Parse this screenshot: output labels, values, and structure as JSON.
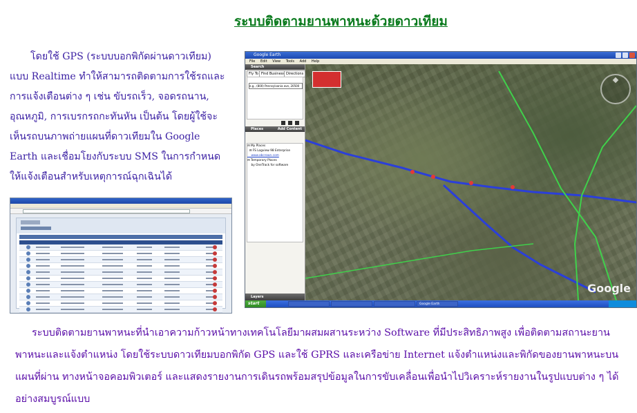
{
  "page": {
    "title": "ระบบติดตามยานพาหนะด้วยดาวเทียม",
    "intro_paragraph": "โดยใช้ GPS (ระบบบอกพิกัดผ่านดาวเทียม) แบบ Realtime ทำให้สามารถติดตามการใช้รถและการแจ้งเตือนต่าง ๆ เช่น ขับรถเร็ว, จอดรถนาน, อุณหภูมิ, การเบรกรถกะทันหัน เป็นต้น  โดยผู้ใช้จะเห็นรถบนภาพถ่ายแผนที่ดาวเทียมใน Google Earth และเชื่อมโยงกับระบบ SMS ในการกำหนดให้แจ้งเตือนสำหรับเหตุการณ์ฉุกเฉินได้",
    "bottom_paragraph": "ระบบติดตามยานพาหนะที่นำเอาความก้าวหน้าทางเทคโนโลยีมาผสมผสานระหว่าง Software ที่มีประสิทธิภาพสูง เพื่อติดตามสถานะยานพาหนะและแจ้งตำแหน่ง โดยใช้ระบบดาวเทียมบอกพิกัด GPS และใช้ GPRS และเครือข่าย Internet แจ้งตำแหน่งและพิกัดของยานพาหนะบนแผนที่ผ่าน ทางหน้าจอคอมพิวเตอร์ และแสดงรายงานการเดินรถพร้อมสรุปข้อมูลในการขับเคลื่อนเพื่อนำไปวิเคราะห์รายงานในรูปแบบต่าง ๆ ได้ อย่างสมบูรณ์แบบ"
  },
  "colors": {
    "title": "#0a7a1d",
    "intro_text": "#3a1fa3",
    "bottom_text": "#5a0ea8"
  },
  "google_earth_screenshot": {
    "window_title": "Google Earth",
    "menu": [
      "File",
      "Edit",
      "View",
      "Tools",
      "Add",
      "Help"
    ],
    "search_header": "Search",
    "search_tabs": [
      "Fly To",
      "Find Businesses",
      "Directions"
    ],
    "search_value": "e.g., (800) Pennsylvania ave, 20500",
    "places_header": "Places",
    "add_content": "Add Content",
    "tree": [
      "My Places",
      "FS Logview 98 Enterprise",
      "www.abcrown.com",
      "Temporary Places",
      "by OneTrack for software"
    ],
    "layers_header": "Layers",
    "start_label": "start",
    "taskbar_items": [
      "",
      "",
      "",
      "Google Earth"
    ],
    "logo": "Google",
    "icons": [
      "compass-icon"
    ]
  },
  "tracking_list_screenshot": {
    "rows": 11
  }
}
